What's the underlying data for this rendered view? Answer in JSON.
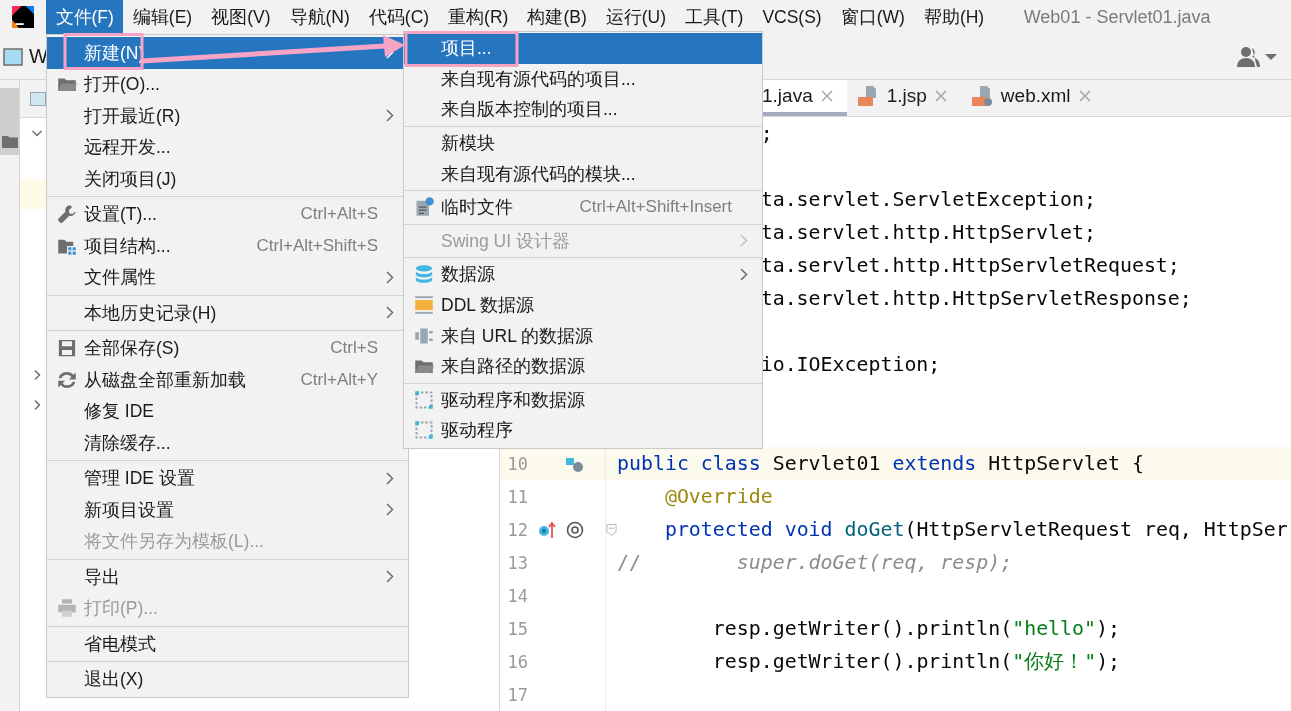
{
  "menu_bar": {
    "items": [
      {
        "label": "文件(F)",
        "selected": true
      },
      {
        "label": "编辑(E)",
        "selected": false
      },
      {
        "label": "视图(V)",
        "selected": false
      },
      {
        "label": "导航(N)",
        "selected": false
      },
      {
        "label": "代码(C)",
        "selected": false
      },
      {
        "label": "重构(R)",
        "selected": false
      },
      {
        "label": "构建(B)",
        "selected": false
      },
      {
        "label": "运行(U)",
        "selected": false
      },
      {
        "label": "工具(T)",
        "selected": false
      },
      {
        "label": "VCS(S)",
        "selected": false
      },
      {
        "label": "窗口(W)",
        "selected": false
      },
      {
        "label": "帮助(H)",
        "selected": false
      }
    ],
    "title": "Web01 - Servlet01.java"
  },
  "toolbar": {
    "project_label": "W"
  },
  "project_tree": [
    {
      "kind": "folder",
      "expanded": true
    },
    {
      "kind": "leaf",
      "current": false
    },
    {
      "kind": "leaf",
      "current": true
    },
    {
      "kind": "leaf",
      "current": false
    },
    {
      "kind": "leaf",
      "current": false
    },
    {
      "kind": "leaf",
      "current": false
    },
    {
      "kind": "leaf",
      "current": false
    },
    {
      "kind": "leaf",
      "current": false
    },
    {
      "kind": "folder",
      "expanded": false
    },
    {
      "kind": "folder",
      "expanded": false
    }
  ],
  "editor": {
    "tabs": [
      {
        "label": "1.java",
        "selected": true
      },
      {
        "label": "1.jsp",
        "selected": false
      },
      {
        "label": "web.xml",
        "selected": false
      }
    ],
    "lines": [
      {
        "kind": "clipped",
        "tokens": [
          {
            "text": ";",
            "kind": "plain"
          }
        ]
      },
      {
        "kind": "blank"
      },
      {
        "kind": "clipped",
        "tokens": [
          {
            "text": "ta.servlet.ServletException;",
            "kind": "plain"
          }
        ]
      },
      {
        "kind": "clipped",
        "tokens": [
          {
            "text": "ta.servlet.http.HttpServlet;",
            "kind": "plain"
          }
        ]
      },
      {
        "kind": "clipped",
        "tokens": [
          {
            "text": "ta.servlet.http.HttpServletRequest;",
            "kind": "plain"
          }
        ]
      },
      {
        "kind": "clipped",
        "tokens": [
          {
            "text": "ta.servlet.http.HttpServletResponse;",
            "kind": "plain"
          }
        ]
      },
      {
        "kind": "blank"
      },
      {
        "kind": "clipped",
        "tokens": [
          {
            "text": "io.IOException;",
            "kind": "plain"
          }
        ]
      },
      {
        "kind": "blank"
      },
      {
        "kind": "blank"
      },
      {
        "kind": "code",
        "number": "10",
        "current": true,
        "tokens": [
          {
            "text": "public class",
            "kind": "keyword"
          },
          {
            "text": " Servlet01 ",
            "kind": "plain"
          },
          {
            "text": "extends",
            "kind": "keyword"
          },
          {
            "text": " HttpServlet {",
            "kind": "plain"
          }
        ]
      },
      {
        "kind": "code",
        "number": "11",
        "current": false,
        "tokens": [
          {
            "text": "    @Override",
            "kind": "annotation"
          }
        ]
      },
      {
        "kind": "code",
        "number": "12",
        "current": false,
        "tokens": [
          {
            "text": "    protected void",
            "kind": "keyword"
          },
          {
            "text": " doGet",
            "kind": "method"
          },
          {
            "text": "(HttpServletRequest req, HttpSer",
            "kind": "plain"
          }
        ]
      },
      {
        "kind": "code",
        "number": "13",
        "current": false,
        "tokens": [
          {
            "text": "//",
            "kind": "comment"
          },
          {
            "text": "        super.doGet(req, resp);",
            "kind": "comment-italic"
          }
        ]
      },
      {
        "kind": "code",
        "number": "14",
        "current": false
      },
      {
        "kind": "code",
        "number": "15",
        "current": false,
        "tokens": [
          {
            "text": "        resp.getWriter().println(",
            "kind": "plain"
          },
          {
            "text": "\"hello\"",
            "kind": "string"
          },
          {
            "text": ");",
            "kind": "plain"
          }
        ]
      },
      {
        "kind": "code",
        "number": "16",
        "current": false,
        "tokens": [
          {
            "text": "        resp.getWriter().println(",
            "kind": "plain"
          },
          {
            "text": "\"你好！\"",
            "kind": "string"
          },
          {
            "text": ");",
            "kind": "plain"
          }
        ]
      },
      {
        "kind": "code",
        "number": "17",
        "current": false
      }
    ]
  },
  "file_menu": [
    {
      "kind": "item",
      "label": "新建(N)",
      "submenu": true,
      "disabled": false,
      "selected": true
    },
    {
      "kind": "item",
      "label": "打开(O)...",
      "submenu": false,
      "disabled": false,
      "selected": false
    },
    {
      "kind": "item",
      "label": "打开最近(R)",
      "submenu": true,
      "disabled": false,
      "selected": false
    },
    {
      "kind": "item",
      "label": "远程开发...",
      "submenu": false,
      "disabled": false,
      "selected": false
    },
    {
      "kind": "item",
      "label": "关闭项目(J)",
      "submenu": false,
      "disabled": false,
      "selected": false
    },
    {
      "kind": "separator"
    },
    {
      "kind": "item",
      "label": "设置(T)...",
      "shortcut": "Ctrl+Alt+S",
      "submenu": false,
      "disabled": false,
      "selected": false
    },
    {
      "kind": "item",
      "label": "项目结构...",
      "shortcut": "Ctrl+Alt+Shift+S",
      "submenu": false,
      "disabled": false,
      "selected": false
    },
    {
      "kind": "item",
      "label": "文件属性",
      "submenu": true,
      "disabled": false,
      "selected": false
    },
    {
      "kind": "separator"
    },
    {
      "kind": "item",
      "label": "本地历史记录(H)",
      "submenu": true,
      "disabled": false,
      "selected": false
    },
    {
      "kind": "separator"
    },
    {
      "kind": "item",
      "label": "全部保存(S)",
      "shortcut": "Ctrl+S",
      "submenu": false,
      "disabled": false,
      "selected": false
    },
    {
      "kind": "item",
      "label": "从磁盘全部重新加载",
      "shortcut": "Ctrl+Alt+Y",
      "submenu": false,
      "disabled": false,
      "selected": false
    },
    {
      "kind": "item",
      "label": "修复 IDE",
      "submenu": false,
      "disabled": false,
      "selected": false
    },
    {
      "kind": "item",
      "label": "清除缓存...",
      "submenu": false,
      "disabled": false,
      "selected": false
    },
    {
      "kind": "separator"
    },
    {
      "kind": "item",
      "label": "管理 IDE 设置",
      "submenu": true,
      "disabled": false,
      "selected": false
    },
    {
      "kind": "item",
      "label": "新项目设置",
      "submenu": true,
      "disabled": false,
      "selected": false
    },
    {
      "kind": "item",
      "label": "将文件另存为模板(L)...",
      "submenu": false,
      "disabled": true,
      "selected": false
    },
    {
      "kind": "separator"
    },
    {
      "kind": "item",
      "label": "导出",
      "submenu": true,
      "disabled": false,
      "selected": false
    },
    {
      "kind": "item",
      "label": "打印(P)...",
      "submenu": false,
      "disabled": true,
      "selected": false
    },
    {
      "kind": "separator"
    },
    {
      "kind": "item",
      "label": "省电模式",
      "submenu": false,
      "disabled": false,
      "selected": false
    },
    {
      "kind": "separator"
    },
    {
      "kind": "item",
      "label": "退出(X)",
      "submenu": false,
      "disabled": false,
      "selected": false
    }
  ],
  "new_submenu": [
    {
      "kind": "item",
      "label": "项目...",
      "submenu": false,
      "disabled": false,
      "selected": true
    },
    {
      "kind": "item",
      "label": "来自现有源代码的项目...",
      "submenu": false,
      "disabled": false,
      "selected": false
    },
    {
      "kind": "item",
      "label": "来自版本控制的项目...",
      "submenu": false,
      "disabled": false,
      "selected": false
    },
    {
      "kind": "separator"
    },
    {
      "kind": "item",
      "label": "新模块",
      "submenu": false,
      "disabled": false,
      "selected": false
    },
    {
      "kind": "item",
      "label": "来自现有源代码的模块...",
      "submenu": false,
      "disabled": false,
      "selected": false
    },
    {
      "kind": "separator"
    },
    {
      "kind": "item",
      "label": "临时文件",
      "shortcut": "Ctrl+Alt+Shift+Insert",
      "submenu": false,
      "disabled": false,
      "selected": false
    },
    {
      "kind": "separator"
    },
    {
      "kind": "item",
      "label": "Swing UI 设计器",
      "submenu": true,
      "disabled": true,
      "selected": false
    },
    {
      "kind": "separator"
    },
    {
      "kind": "item",
      "label": "数据源",
      "submenu": true,
      "disabled": false,
      "selected": false
    },
    {
      "kind": "item",
      "label": "DDL 数据源",
      "submenu": false,
      "disabled": false,
      "selected": false
    },
    {
      "kind": "item",
      "label": "来自 URL 的数据源",
      "submenu": false,
      "disabled": false,
      "selected": false
    },
    {
      "kind": "item",
      "label": "来自路径的数据源",
      "submenu": false,
      "disabled": false,
      "selected": false
    },
    {
      "kind": "separator"
    },
    {
      "kind": "item",
      "label": "驱动程序和数据源",
      "submenu": false,
      "disabled": false,
      "selected": false
    },
    {
      "kind": "item",
      "label": "驱动程序",
      "submenu": false,
      "disabled": false,
      "selected": false
    }
  ]
}
